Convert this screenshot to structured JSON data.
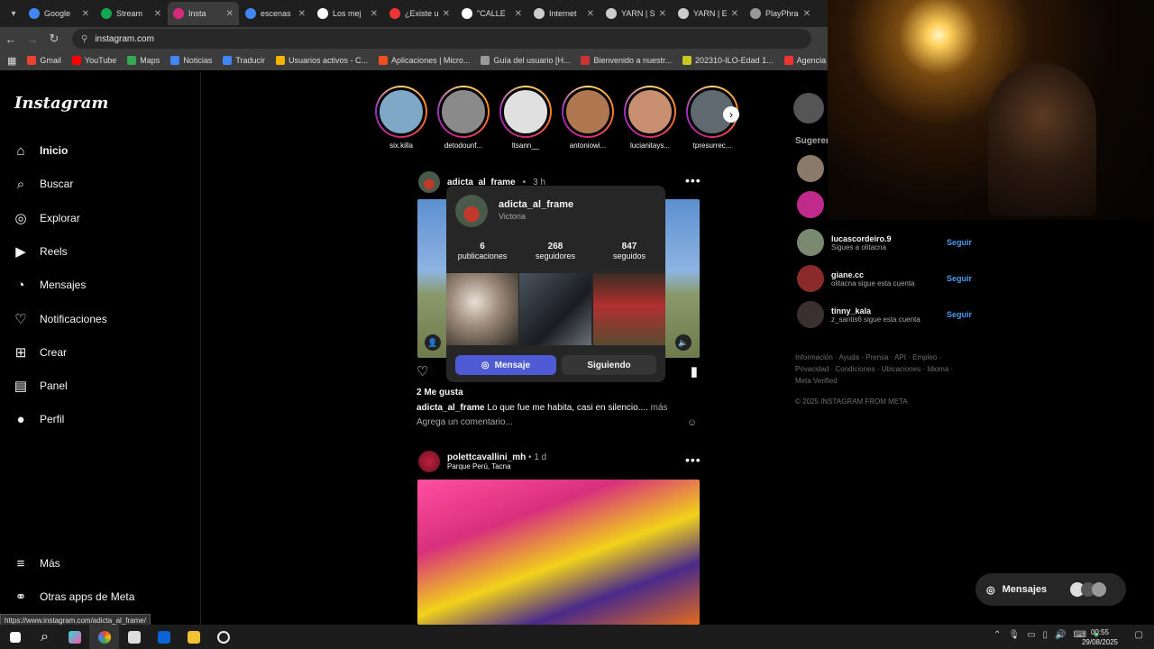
{
  "browser": {
    "tabs": [
      {
        "title": "Google",
        "color": "#4285f4",
        "active": false
      },
      {
        "title": "Stream",
        "color": "#12a84f",
        "active": false
      },
      {
        "title": "Insta",
        "color": "#d6297a",
        "active": true
      },
      {
        "title": "escenas",
        "color": "#4285f4",
        "active": false
      },
      {
        "title": "Los mej",
        "color": "#ffffff",
        "active": false
      },
      {
        "title": "¿Existe u",
        "color": "#e33",
        "active": false
      },
      {
        "title": "\"CALLE",
        "color": "#ffffff",
        "active": false
      },
      {
        "title": "Internet",
        "color": "#cccccc",
        "active": false
      },
      {
        "title": "YARN | S",
        "color": "#cccccc",
        "active": false
      },
      {
        "title": "YARN | E",
        "color": "#cccccc",
        "active": false
      },
      {
        "title": "PlayPhra",
        "color": "#999999",
        "active": false
      }
    ],
    "url": "instagram.com",
    "bookmarks": [
      {
        "label": "Gmail",
        "color": "#ea4335"
      },
      {
        "label": "YouTube",
        "color": "#ff0000"
      },
      {
        "label": "Maps",
        "color": "#34a853"
      },
      {
        "label": "Noticias",
        "color": "#4285f4"
      },
      {
        "label": "Traducir",
        "color": "#4285f4"
      },
      {
        "label": "Usuarios activos - C...",
        "color": "#f4b400"
      },
      {
        "label": "Aplicaciones | Micro...",
        "color": "#f25022"
      },
      {
        "label": "Guía del usuario [H...",
        "color": "#999999"
      },
      {
        "label": "Bienvenido a nuestr...",
        "color": "#cc3333"
      },
      {
        "label": "202310-ILO-Edad 1...",
        "color": "#c9c920"
      },
      {
        "label": "Agencia Inmobiliari...",
        "color": "#e33"
      }
    ],
    "status_url": "https://www.instagram.com/adicta_al_frame/"
  },
  "sidebar": {
    "logo": "Instagram",
    "items": [
      {
        "label": "Inicio",
        "icon": "home-icon",
        "bold": true
      },
      {
        "label": "Buscar",
        "icon": "search-icon"
      },
      {
        "label": "Explorar",
        "icon": "compass-icon"
      },
      {
        "label": "Reels",
        "icon": "reels-icon"
      },
      {
        "label": "Mensajes",
        "icon": "messenger-icon"
      },
      {
        "label": "Notificaciones",
        "icon": "heart-icon"
      },
      {
        "label": "Crear",
        "icon": "plus-square-icon"
      },
      {
        "label": "Panel",
        "icon": "panel-icon"
      },
      {
        "label": "Perfil",
        "icon": "avatar-icon"
      }
    ],
    "bottom": [
      {
        "label": "Más",
        "icon": "menu-icon"
      },
      {
        "label": "Otras apps de Meta",
        "icon": "meta-apps-icon"
      }
    ]
  },
  "stories": [
    "six.killa",
    "detodounf...",
    "ltsann__",
    "antoniowi...",
    "lucianitays...",
    "tpresurrec..."
  ],
  "post1": {
    "username": "adicta_al_frame",
    "time": "3 h",
    "likes": "2 Me gusta",
    "caption_user": "adicta_al_frame",
    "caption_text": "Lo que fue me habita, casi en silencio....",
    "more": "más",
    "comment_placeholder": "Agrega un comentario..."
  },
  "popup": {
    "name": "adicta_al_frame",
    "subtitle": "Victoria",
    "stats": [
      {
        "value": "6",
        "label": "publicaciones"
      },
      {
        "value": "268",
        "label": "seguidores"
      },
      {
        "value": "847",
        "label": "seguidos"
      }
    ],
    "message_btn": "Mensaje",
    "following_btn": "Siguiendo"
  },
  "post2": {
    "username": "polettcavallini_mh",
    "time": "1 d",
    "location": "Parque Perú, Tacna"
  },
  "suggestions": {
    "title": "Sugeren",
    "items": [
      {
        "name": "lucascordeiro.9",
        "sub": "Sigues a olitacna",
        "action": "Seguir"
      },
      {
        "name": "giane.cc",
        "sub": "olitacna sigue esta cuenta",
        "action": "Seguir"
      },
      {
        "name": "tinny_kala",
        "sub": "z_santis6 sigue esta cuenta",
        "action": "Seguir"
      }
    ],
    "footer_line1": "Información · Ayuda · Prensa · API · Empleo ·",
    "footer_line2": "Privacidad · Condiciones · Ubicaciones · Idioma ·",
    "footer_line3": "Meta Verified",
    "copyright": "© 2025 INSTAGRAM FROM META"
  },
  "messages_pill": "Mensajes",
  "clock": {
    "time": "00:55",
    "date": "29/08/2025"
  }
}
